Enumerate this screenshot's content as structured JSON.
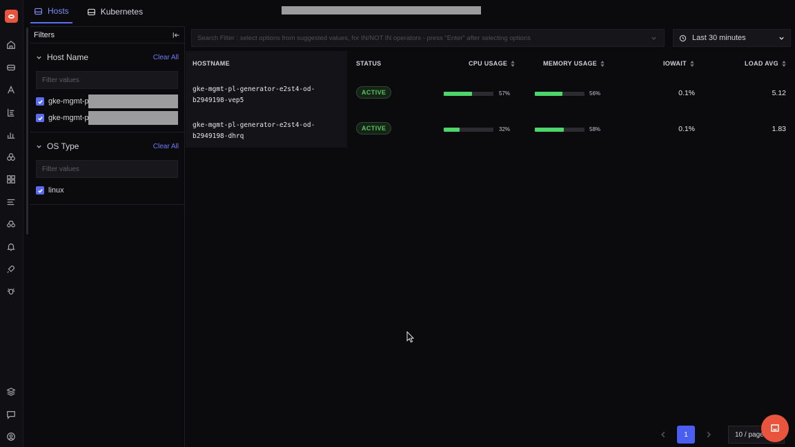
{
  "tabs": [
    {
      "label": "Hosts",
      "active": true
    },
    {
      "label": "Kubernetes",
      "active": false
    }
  ],
  "filters": {
    "title": "Filters",
    "sections": [
      {
        "title": "Host Name",
        "clear_label": "Clear All",
        "placeholder": "Filter values",
        "options": [
          {
            "label": "gke-mgmt-p",
            "checked": true
          },
          {
            "label": "gke-mgmt-p",
            "checked": true
          }
        ]
      },
      {
        "title": "OS Type",
        "clear_label": "Clear All",
        "placeholder": "Filter values",
        "options": [
          {
            "label": "linux",
            "checked": true
          }
        ]
      }
    ]
  },
  "search": {
    "placeholder": "Search Filter : select options from suggested values, for IN/NOT IN operators - press \"Enter\" after selecting options"
  },
  "time_range": {
    "label": "Last 30 minutes"
  },
  "table": {
    "columns": [
      "HOSTNAME",
      "STATUS",
      "CPU USAGE",
      "MEMORY USAGE",
      "IOWAIT",
      "LOAD AVG"
    ],
    "rows": [
      {
        "hostname": "gke-mgmt-pl-generator-e2st4-od-b2949198-vep5",
        "status": "ACTIVE",
        "cpu": 57,
        "cpu_label": "57%",
        "memory": 56,
        "memory_label": "56%",
        "iowait": "0.1%",
        "load_avg": "5.12"
      },
      {
        "hostname": "gke-mgmt-pl-generator-e2st4-od-b2949198-dhrq",
        "status": "ACTIVE",
        "cpu": 32,
        "cpu_label": "32%",
        "memory": 58,
        "memory_label": "58%",
        "iowait": "0.1%",
        "load_avg": "1.83"
      }
    ]
  },
  "pagination": {
    "current_page": "1",
    "page_size": "10 / page"
  },
  "colors": {
    "accent": "#5b6cf0",
    "brand": "#e8553c",
    "bar": "#4cd66b",
    "active": "#57c760"
  }
}
